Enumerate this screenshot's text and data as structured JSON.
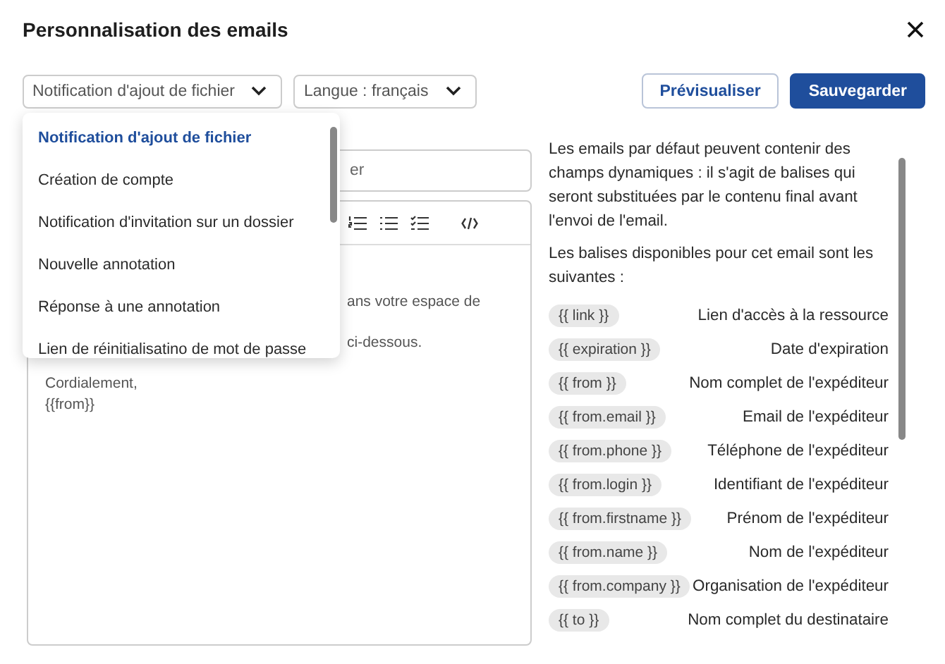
{
  "window": {
    "title": "Personnalisation des emails"
  },
  "selects": [
    {
      "label": "Notification d'ajout de fichier"
    },
    {
      "label": "Langue : français"
    }
  ],
  "buttons": [
    {
      "label": "Prévisualiser",
      "kind": "secondary"
    },
    {
      "label": "Sauvegarder",
      "kind": "primary"
    }
  ],
  "dropdown": {
    "items": [
      {
        "label": "Notification d'ajout de fichier",
        "selected": true
      },
      {
        "label": "Création de compte",
        "selected": false
      },
      {
        "label": "Notification d'invitation sur un dossier",
        "selected": false
      },
      {
        "label": "Nouvelle annotation",
        "selected": false
      },
      {
        "label": "Réponse à une annotation",
        "selected": false
      },
      {
        "label": "Lien de réinitialisatino de mot de passe",
        "selected": false
      }
    ]
  },
  "subject": {
    "value": "er"
  },
  "editor": {
    "tools": [
      {
        "kind": "ordered-list"
      },
      {
        "kind": "bullet-list"
      },
      {
        "kind": "checklist"
      },
      {
        "kind": "code"
      }
    ],
    "visible_fragments": [
      "ans votre espace de",
      "ci-dessous."
    ],
    "lines": [
      "Cordialement,",
      "{{from}}"
    ]
  },
  "info": [
    "Les emails par défaut peuvent contenir des champs dynamiques : il s'agit de balises qui seront substituées par le contenu final avant l'envoi de l'email.",
    "Les balises disponibles pour cet email sont les suivantes :"
  ],
  "tags": [
    {
      "tag": "{{ link }}",
      "description": "Lien d'accès à la ressource"
    },
    {
      "tag": "{{ expiration }}",
      "description": "Date d'expiration"
    },
    {
      "tag": "{{ from }}",
      "description": "Nom complet de l'expéditeur"
    },
    {
      "tag": "{{ from.email }}",
      "description": "Email de l'expéditeur"
    },
    {
      "tag": "{{ from.phone }}",
      "description": "Téléphone de l'expéditeur"
    },
    {
      "tag": "{{ from.login }}",
      "description": "Identifiant de l'expéditeur"
    },
    {
      "tag": "{{ from.firstname }}",
      "description": "Prénom de l'expéditeur"
    },
    {
      "tag": "{{ from.name }}",
      "description": "Nom de l'expéditeur"
    },
    {
      "tag": "{{ from.company }}",
      "description": "Organisation de l'expéditeur"
    },
    {
      "tag": "{{ to }}",
      "description": "Nom complet du destinataire"
    }
  ]
}
